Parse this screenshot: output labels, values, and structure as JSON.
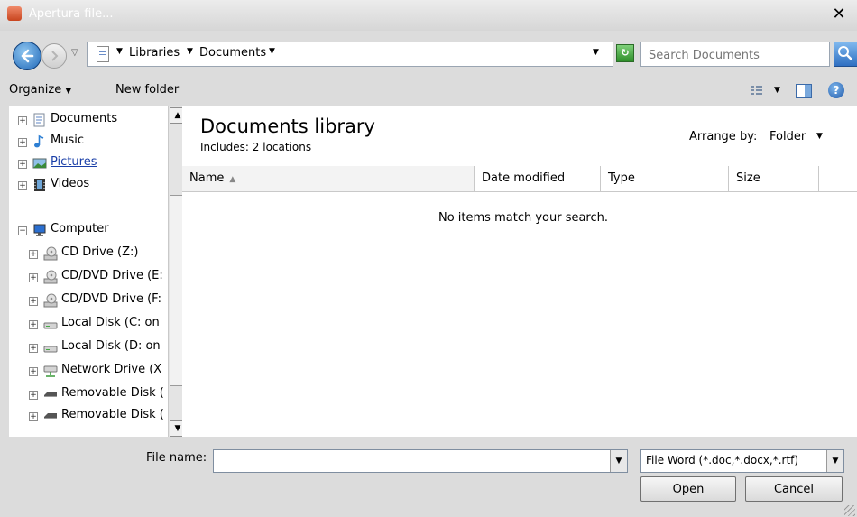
{
  "window": {
    "title": "Apertura file...",
    "close_glyph": "✕"
  },
  "address": {
    "crumbs": [
      "Libraries",
      "Documents"
    ],
    "search_placeholder": "Search Documents"
  },
  "toolbar": {
    "organize": "Organize",
    "new_folder": "New folder"
  },
  "nav": {
    "items": [
      {
        "label": "Documents",
        "icon": "documents-library-icon",
        "expander": "+"
      },
      {
        "label": "Music",
        "icon": "music-note-icon",
        "expander": "+"
      },
      {
        "label": "Pictures",
        "icon": "pictures-library-icon",
        "expander": "+"
      },
      {
        "label": "Videos",
        "icon": "videos-library-icon",
        "expander": "+"
      },
      {
        "label": "Computer",
        "icon": "computer-icon",
        "expander": "−"
      },
      {
        "label": "CD Drive (Z:)",
        "icon": "cd-drive-icon",
        "expander": "+"
      },
      {
        "label": "CD/DVD Drive (E:",
        "icon": "cd-drive-icon",
        "expander": "+"
      },
      {
        "label": "CD/DVD Drive (F:",
        "icon": "cd-drive-icon",
        "expander": "+"
      },
      {
        "label": "Local Disk (C: on",
        "icon": "local-disk-icon",
        "expander": "+"
      },
      {
        "label": "Local Disk (D: on",
        "icon": "local-disk-icon",
        "expander": "+"
      },
      {
        "label": "Network Drive (X",
        "icon": "network-drive-icon",
        "expander": "+"
      },
      {
        "label": "Removable Disk (",
        "icon": "removable-disk-icon",
        "expander": "+"
      },
      {
        "label": "Removable Disk (",
        "icon": "removable-disk-icon",
        "expander": "+"
      }
    ]
  },
  "content": {
    "title": "Documents library",
    "subtitle": "Includes: 2 locations",
    "arrange_label": "Arrange by:",
    "arrange_value": "Folder",
    "columns": [
      "Name",
      "Date modified",
      "Type",
      "Size"
    ],
    "empty_message": "No items match your search."
  },
  "bottom": {
    "file_name_label": "File name:",
    "file_name_value": "",
    "file_type": "File Word (*.doc,*.docx,*.rtf)",
    "open_label": "Open",
    "cancel_label": "Cancel"
  }
}
